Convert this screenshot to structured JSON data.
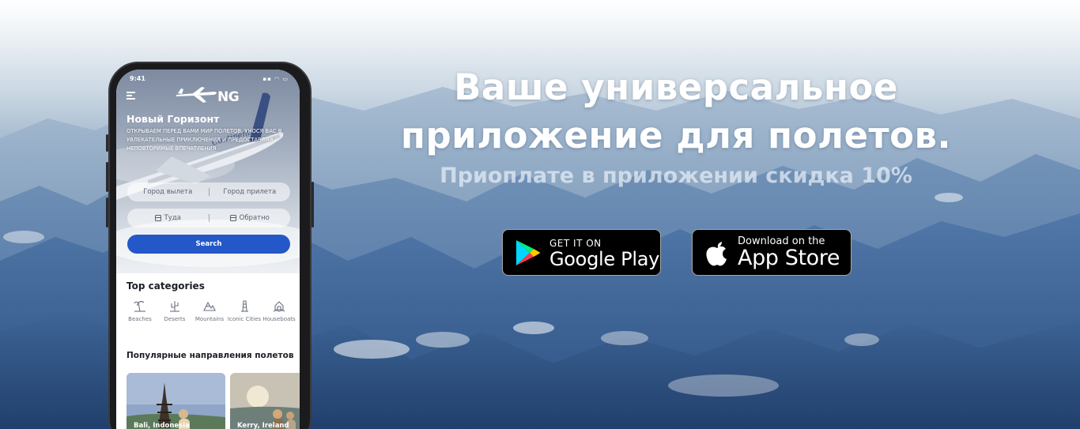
{
  "hero": {
    "headline_line1": "Ваше универсальное",
    "headline_line2": "приложение для полетов.",
    "subline": "Приоплате в приложении скидка 10%"
  },
  "stores": {
    "google_small": "GET IT ON",
    "google_big": "Google Play",
    "apple_small": "Download on the",
    "apple_big": "App Store"
  },
  "phone": {
    "time": "9:41",
    "logo": "NG",
    "app_title": "Новый Горизонт",
    "app_description": "Открываем перед вами мир полетов, унося вас в увлекательные приключения и предоставляя неповторимые впечатления",
    "from_placeholder": "Город вылета",
    "to_placeholder": "Город прилета",
    "depart_label": "Туда",
    "return_label": "Обратно",
    "search_label": "Search",
    "categories_title": "Top categories",
    "categories": [
      {
        "label": "Beaches",
        "icon": "beach-icon"
      },
      {
        "label": "Deserts",
        "icon": "cactus-icon"
      },
      {
        "label": "Mountains",
        "icon": "mountain-icon"
      },
      {
        "label": "Iconic Cities",
        "icon": "tower-icon"
      },
      {
        "label": "Houseboats",
        "icon": "houseboat-icon"
      }
    ],
    "destinations_title": "Популярные направления полетов",
    "destinations": [
      {
        "name": "Bali, Indonesia"
      },
      {
        "name": "Kerry, Ireland"
      }
    ]
  },
  "colors": {
    "accent": "#2457c8",
    "button_bg": "#000000",
    "headline": "#ffffff"
  }
}
